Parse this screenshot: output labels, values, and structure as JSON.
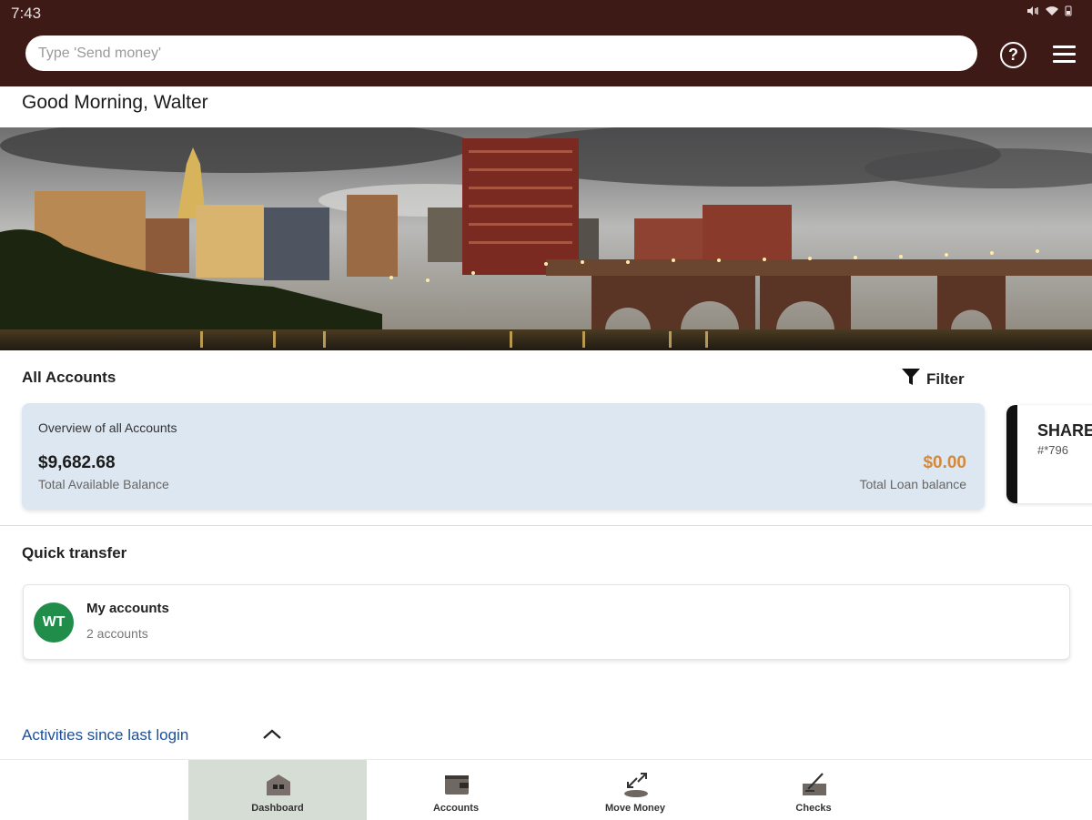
{
  "status_bar": {
    "time": "7:43"
  },
  "search": {
    "placeholder": "Type 'Send money'"
  },
  "header": {
    "greeting": "Good Morning, Walter"
  },
  "accounts": {
    "title": "All Accounts",
    "filter_label": "Filter",
    "overview": {
      "title": "Overview of all Accounts",
      "available_balance": "$9,682.68",
      "available_label": "Total Available Balance",
      "loan_balance": "$0.00",
      "loan_label": "Total Loan balance"
    },
    "share_card": {
      "name": "SHARE",
      "number": "#*796"
    }
  },
  "quick_transfer": {
    "title": "Quick transfer",
    "initials": "WT",
    "name": "My accounts",
    "subtitle": "2 accounts"
  },
  "activities": {
    "label": "Activities since last login"
  },
  "bottom_nav": [
    {
      "label": "Dashboard",
      "icon": "dashboard-icon",
      "active": true
    },
    {
      "label": "Accounts",
      "icon": "wallet-icon",
      "active": false
    },
    {
      "label": "Move Money",
      "icon": "move-money-icon",
      "active": false
    },
    {
      "label": "Checks",
      "icon": "check-icon",
      "active": false
    }
  ],
  "colors": {
    "app_bar": "#3e1a17",
    "overview_card": "#dde7f1",
    "loan_amount": "#d3893c",
    "avatar": "#218d4b",
    "link": "#1d4f99",
    "active_nav": "#d5ddd4"
  }
}
